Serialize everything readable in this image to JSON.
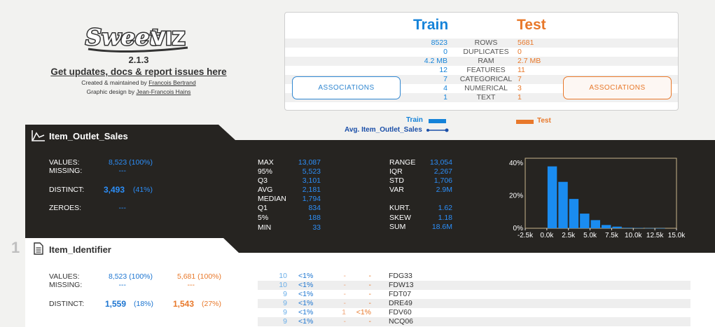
{
  "logo": {
    "text": "SweetVIZ"
  },
  "version": "2.1.3",
  "updates_link": "Get updates, docs & report issues here",
  "credits": {
    "created_prefix": "Created & maintained by",
    "created_name": "Francois Bertrand",
    "design_prefix": "Graphic design by",
    "design_name": "Jean-Francois Hains"
  },
  "summary": {
    "train_label": "Train",
    "test_label": "Test",
    "rows": [
      {
        "train": "8523",
        "label": "ROWS",
        "test": "5681"
      },
      {
        "train": "0",
        "label": "DUPLICATES",
        "test": "0"
      },
      {
        "train": "4.2 MB",
        "label": "RAM",
        "test": "2.7 MB"
      },
      {
        "train": "12",
        "label": "FEATURES",
        "test": "11"
      },
      {
        "train": "7",
        "label": "CATEGORICAL",
        "test": "7"
      },
      {
        "train": "4",
        "label": "NUMERICAL",
        "test": "3"
      },
      {
        "train": "1",
        "label": "TEXT",
        "test": "1"
      }
    ],
    "assoc_train": "ASSOCIATIONS",
    "assoc_test": "ASSOCIATIONS"
  },
  "legend": {
    "train": "Train",
    "test": "Test",
    "avg": "Avg. Item_Outlet_Sales"
  },
  "colors": {
    "train": "#1583d9",
    "test": "#e8782a",
    "dark": "#262421",
    "bars": "#1a8cf0"
  },
  "feature1": {
    "index": "",
    "name": "Item_Outlet_Sales",
    "icon": "line-chart-icon",
    "values_label": "VALUES:",
    "values": "8,523 (100%)",
    "missing_label": "MISSING:",
    "missing": "---",
    "distinct_label": "DISTINCT:",
    "distinct": "3,493",
    "distinct_pct": "(41%)",
    "zeroes_label": "ZEROES:",
    "zeroes": "---",
    "stats_mid": [
      {
        "label": "MAX",
        "value": "13,087"
      },
      {
        "label": "95%",
        "value": "5,523"
      },
      {
        "label": "Q3",
        "value": "3,101"
      },
      {
        "label": "AVG",
        "value": "2,181"
      },
      {
        "label": "MEDIAN",
        "value": "1,794"
      },
      {
        "label": "Q1",
        "value": "834"
      },
      {
        "label": "5%",
        "value": "188"
      },
      {
        "label": "MIN",
        "value": "33"
      }
    ],
    "stats_right_top": [
      {
        "label": "RANGE",
        "value": "13,054"
      },
      {
        "label": "IQR",
        "value": "2,267"
      },
      {
        "label": "STD",
        "value": "1,706"
      },
      {
        "label": "VAR",
        "value": "2.9M"
      }
    ],
    "stats_right_bottom": [
      {
        "label": "KURT.",
        "value": "1.62"
      },
      {
        "label": "SKEW",
        "value": "1.18"
      },
      {
        "label": "SUM",
        "value": "18.6M"
      }
    ]
  },
  "chart_data": {
    "type": "bar",
    "x": [
      0,
      1250,
      2500,
      3750,
      5000,
      6250,
      7500,
      8750,
      10000,
      11250,
      12500
    ],
    "values": [
      38,
      28.5,
      18,
      9,
      5,
      2,
      1,
      0.3,
      0.2,
      0.1,
      0.05
    ],
    "bin_width": 1250,
    "xlim": [
      -2500,
      15000
    ],
    "ylim": [
      0,
      43
    ],
    "xticks": [
      "-2.5k",
      "0.0k",
      "2.5k",
      "5.0k",
      "7.5k",
      "10.0k",
      "12.5k",
      "15.0k"
    ],
    "xtick_values": [
      -2500,
      0,
      2500,
      5000,
      7500,
      10000,
      12500,
      15000
    ],
    "yticks": [
      "0%",
      "20%",
      "40%"
    ],
    "ytick_values": [
      0,
      20,
      40
    ]
  },
  "feature2": {
    "index": "1",
    "name": "Item_Identifier",
    "icon": "document-icon",
    "values_label": "VALUES:",
    "values_train": "8,523 (100%)",
    "values_test": "5,681 (100%)",
    "missing_label": "MISSING:",
    "missing_train": "---",
    "missing_test": "---",
    "distinct_label": "DISTINCT:",
    "distinct_train": "1,559",
    "distinct_train_pct": "(18%)",
    "distinct_test": "1,543",
    "distinct_test_pct": "(27%)",
    "freq": [
      {
        "count": "10",
        "pct": "<1%",
        "tcount": "-",
        "tpct": "-",
        "label": "FDG33"
      },
      {
        "count": "10",
        "pct": "<1%",
        "tcount": "-",
        "tpct": "-",
        "label": "FDW13"
      },
      {
        "count": "9",
        "pct": "<1%",
        "tcount": "-",
        "tpct": "-",
        "label": "FDT07"
      },
      {
        "count": "9",
        "pct": "<1%",
        "tcount": "-",
        "tpct": "-",
        "label": "DRE49"
      },
      {
        "count": "9",
        "pct": "<1%",
        "tcount": "1",
        "tpct": "<1%",
        "label": "FDV60"
      },
      {
        "count": "9",
        "pct": "<1%",
        "tcount": "-",
        "tpct": "-",
        "label": "NCQ06"
      }
    ]
  }
}
